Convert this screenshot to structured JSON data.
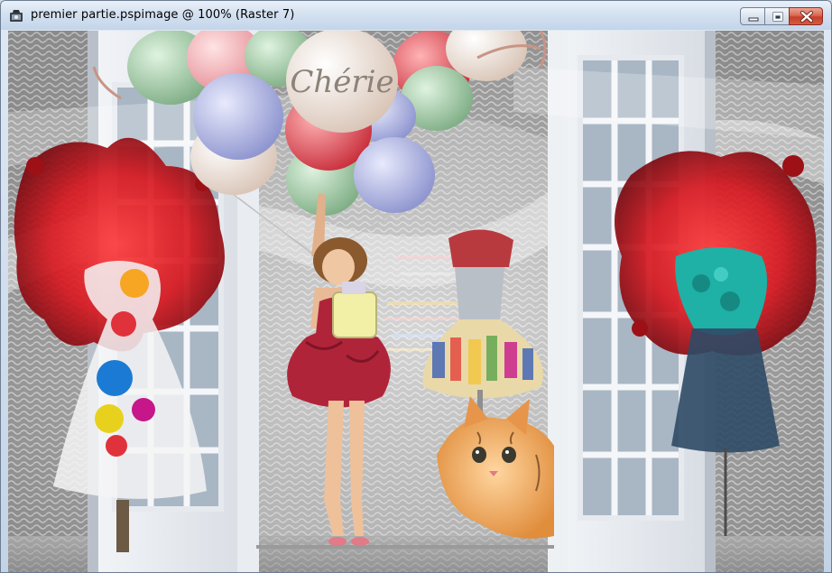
{
  "window": {
    "title": "premier partie.pspimage @ 100% (Raster 7)",
    "app_icon": "paintshop-pro-icon",
    "controls": {
      "minimize": "minimize-icon",
      "maximize": "maximize-icon",
      "close": "close-icon"
    }
  },
  "image": {
    "caption": "Chérie",
    "colors": {
      "frame": "#c9d8ea",
      "red_splash": "#d81820",
      "dress": "#b0243a",
      "close_button": "#d2523a"
    }
  }
}
